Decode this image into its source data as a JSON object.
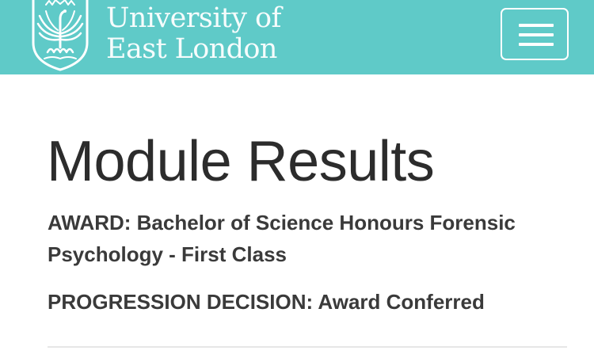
{
  "header": {
    "background_color": "#5fcac8",
    "logo": {
      "icon": "phoenix-crest-icon",
      "line1": "University of",
      "line2": "East London"
    },
    "menu_button": {
      "icon": "hamburger-menu-icon"
    }
  },
  "main": {
    "title": "Module Results",
    "award": "AWARD: Bachelor of Science Honours Forensic Psychology - First Class",
    "progression": "PROGRESSION DECISION: Award Conferred"
  }
}
